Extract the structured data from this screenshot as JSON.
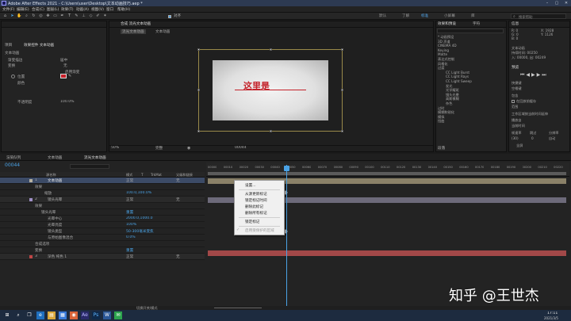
{
  "window": {
    "title": "Adobe After Effects 2021 - C:\\Users\\user\\Desktop\\文本动画技巧.aep *"
  },
  "menu": [
    "文件(F)",
    "编辑(E)",
    "合成(C)",
    "图层(L)",
    "效果(T)",
    "动画(A)",
    "视图(V)",
    "窗口",
    "帮助(H)"
  ],
  "toolbar": {
    "snap_label": "对齐",
    "workspaces": [
      "默认",
      "了解",
      "标准",
      "小屏幕",
      "库"
    ],
    "active_ws": "标准",
    "search_placeholder": "搜索帮助"
  },
  "effects_panel": {
    "tabs": [
      "项目",
      "效果控件 文本动画"
    ],
    "layer": "文本动画",
    "rows": [
      "渐变描边",
      "变换",
      "位置",
      "颜色",
      "不透明度"
    ],
    "values": [
      "居中",
      "无",
      "启用渐变",
      "",
      "100.0%"
    ]
  },
  "comp_panel": {
    "tab": "合成 流光文本动画",
    "breadcrumb": [
      "流光文本动画",
      "文本动画"
    ],
    "text": "这里是",
    "zoom": "50%",
    "quality": "完整",
    "timecode": "00044"
  },
  "effects_presets": {
    "tab": "效果和预设",
    "tab2": "字符",
    "items": [
      "* 动画预设",
      "3D 声道",
      "CINEMA 4D",
      "Keying",
      "Matte",
      "表达式控制",
      "风格化",
      "过渡",
      "过时",
      "模糊和锐化",
      "模拟",
      "扭曲",
      "生成",
      "时间"
    ],
    "sub_items": [
      "CC Light Burst",
      "CC Light Rays",
      "CC Light Sweep",
      "发光",
      "光学耀斑",
      "镜头光晕",
      "高斯模糊",
      "杂色"
    ]
  },
  "info_panel": {
    "title": "信息",
    "rows": [
      "R: 0",
      "G: 0",
      "B: 0",
      "A: 0",
      "X: 1928",
      "Y: 1126"
    ],
    "layer_name": "文本动画",
    "duration": "持续时间: 00250",
    "in_out": "入: 00000, 出: 00249"
  },
  "preview_panel": {
    "title": "预览",
    "shortcut_label": "快捷键",
    "shortcut_value": "空格键",
    "include_label": "包含",
    "cache_label": "在回放前缓存",
    "range_label": "范围",
    "range_value": "工作区域按当前时间延伸",
    "play_from_label": "播放自",
    "play_from_value": "当前时间",
    "fps_label": "帧速率",
    "skip_label": "跳过",
    "res_label": "分辨率",
    "fps_value": "(30)",
    "skip_value": "0",
    "res_value": "自动",
    "fullscreen": "全屏"
  },
  "paragraph_tab": "段落",
  "timeline": {
    "tabs": [
      "渲染队列",
      "文本动画",
      "流光文本动画"
    ],
    "timecode": "00044",
    "columns": [
      "源名称",
      "模式",
      "T",
      "TrkMat",
      "父级和链接"
    ],
    "ruler": [
      "00000",
      "00010",
      "00020",
      "00030",
      "00040",
      "00050",
      "00060",
      "00070",
      "00080",
      "00090",
      "00100",
      "00110",
      "00120",
      "00130",
      "00140",
      "00150",
      "00160",
      "00170",
      "00180",
      "00190",
      "00200",
      "00210",
      "00220"
    ],
    "layers": [
      {
        "num": "1",
        "name": "文本动画",
        "mode": "正常",
        "parent": "无"
      },
      {
        "num": "",
        "name": "效果",
        "mode": "",
        "parent": ""
      },
      {
        "num": "",
        "name": "缩放",
        "mode": "100.0,100.0%",
        "parent": ""
      },
      {
        "num": "2",
        "name": "镜头光晕",
        "mode": "正常",
        "parent": "无"
      },
      {
        "num": "",
        "name": "效果",
        "mode": "",
        "parent": ""
      },
      {
        "num": "",
        "name": "镜头光晕",
        "mode": "重置",
        "parent": ""
      },
      {
        "num": "",
        "name": "光晕中心",
        "mode": "2000.0,1000.0",
        "parent": ""
      },
      {
        "num": "",
        "name": "光晕亮度",
        "mode": "100%",
        "parent": ""
      },
      {
        "num": "",
        "name": "镜头类型",
        "mode": "50-300毫米变焦",
        "parent": ""
      },
      {
        "num": "",
        "name": "与原始图像混合",
        "mode": "0.0%",
        "parent": ""
      },
      {
        "num": "",
        "name": "合成选项",
        "mode": "",
        "parent": ""
      },
      {
        "num": "",
        "name": "变换",
        "mode": "重置",
        "parent": ""
      },
      {
        "num": "3",
        "name": "深色 纯色 1",
        "mode": "正常",
        "parent": "无"
      }
    ],
    "footer": "切换开关/模式"
  },
  "context_menu": {
    "items": [
      "设置...",
      "从源更新标记",
      "锁定标记时间",
      "删除此标记",
      "删除所有标记"
    ],
    "items2": [
      "锁定标记"
    ],
    "disabled": "启用受保护的区域"
  },
  "taskbar": {
    "time": "17:11",
    "date": "2021/3/5"
  },
  "watermark": "知乎 @王世杰"
}
